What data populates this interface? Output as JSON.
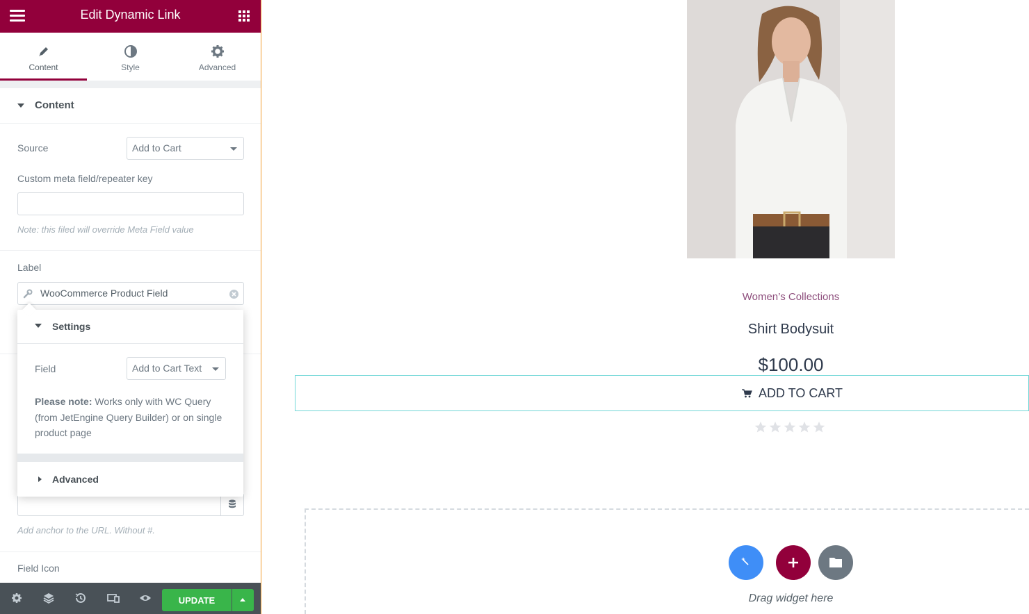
{
  "panel": {
    "header_title": "Edit Dynamic Link",
    "tabs": [
      {
        "label": "Content",
        "icon": "pencil-icon",
        "active": true
      },
      {
        "label": "Style",
        "icon": "half-circle-icon",
        "active": false
      },
      {
        "label": "Advanced",
        "icon": "gear-icon",
        "active": false
      }
    ],
    "section_title": "Content",
    "source_label": "Source",
    "source_value": "Add to Cart",
    "meta_key_label": "Custom meta field/repeater key",
    "meta_key_value": "",
    "meta_note": "Note: this filed will override Meta Field value",
    "label_label": "Label",
    "label_dynamic_value": "WooCommerce Product Field",
    "anchor_note": "Add anchor to the URL. Without #.",
    "field_icon_label": "Field Icon"
  },
  "popover": {
    "settings_title": "Settings",
    "field_label": "Field",
    "field_value": "Add to Cart Text",
    "note_strong": "Please note:",
    "note_text": " Works only with WC Query (from JetEngine Query Builder) or on single product page",
    "advanced_title": "Advanced"
  },
  "footer": {
    "update_label": "UPDATE",
    "icons": [
      "settings-icon",
      "layers-icon",
      "history-icon",
      "responsive-icon",
      "preview-eye-icon"
    ]
  },
  "product": {
    "category": "Women’s Collections",
    "name": "Shirt Bodysuit",
    "price": "$100.00",
    "add_to_cart": "ADD TO CART",
    "rating_stars": 5,
    "rating_value": 0
  },
  "dropzone": {
    "label": "Drag widget here"
  },
  "colors": {
    "brand": "#92003b",
    "update_green": "#39b54a",
    "footer_bg": "#495157",
    "price_text": "#2f3a4c",
    "category_text": "#8e4f7d",
    "selected_outline": "#71d7d7",
    "fab_blue": "#3f8ef7",
    "fab_gray": "#6d7882"
  }
}
